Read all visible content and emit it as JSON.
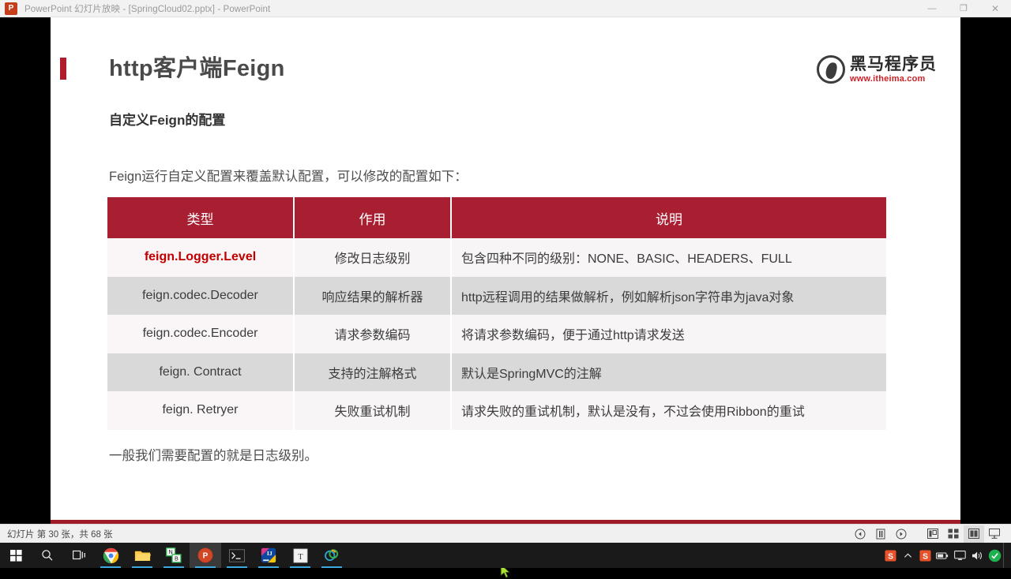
{
  "window": {
    "app_icon_label": "P",
    "title": "PowerPoint 幻灯片放映 - [SpringCloud02.pptx] - PowerPoint",
    "minimize_label": "—",
    "restore_label": "❐",
    "close_label": "✕"
  },
  "slide": {
    "title": "http客户端Feign",
    "subhead": "自定义Feign的配置",
    "intro": "Feign运行自定义配置来覆盖默认配置，可以修改的配置如下：",
    "closing": "一般我们需要配置的就是日志级别。",
    "accent_color": "#b01b2e",
    "header_color": "#a81f32",
    "footer_color": "#9e1b28",
    "highlight_color": "#c00000",
    "logo": {
      "brand_cn": "黑马程序员",
      "url": "www.itheima.com"
    },
    "table": {
      "headers": [
        "类型",
        "作用",
        "说明"
      ],
      "rows": [
        {
          "type": "feign.Logger.Level",
          "role": "修改日志级别",
          "desc": "包含四种不同的级别：NONE、BASIC、HEADERS、FULL",
          "highlight": true
        },
        {
          "type": "feign.codec.Decoder",
          "role": "响应结果的解析器",
          "desc": "http远程调用的结果做解析，例如解析json字符串为java对象",
          "highlight": false
        },
        {
          "type": "feign.codec.Encoder",
          "role": "请求参数编码",
          "desc": "将请求参数编码，便于通过http请求发送",
          "highlight": false
        },
        {
          "type": "feign. Contract",
          "role": "支持的注解格式",
          "desc": "默认是SpringMVC的注解",
          "highlight": false
        },
        {
          "type": "feign. Retryer",
          "role": "失败重试机制",
          "desc": "请求失败的重试机制，默认是没有，不过会使用Ribbon的重试",
          "highlight": false
        }
      ]
    }
  },
  "statusbar": {
    "slide_counter": "幻灯片 第 30 张，共 68 张",
    "controls": [
      {
        "name": "previous-slide-button"
      },
      {
        "name": "pause-slideshow-button"
      },
      {
        "name": "play-slideshow-button"
      },
      {
        "name": "normal-view-button"
      },
      {
        "name": "slide-sorter-view-button"
      },
      {
        "name": "reading-view-button"
      },
      {
        "name": "slideshow-view-button"
      }
    ]
  },
  "taskbar": {
    "items": [
      {
        "name": "start-button",
        "label": ""
      },
      {
        "name": "search-button",
        "label": ""
      },
      {
        "name": "task-view-button",
        "label": ""
      },
      {
        "name": "chrome-button",
        "label": ""
      },
      {
        "name": "file-explorer-button",
        "label": ""
      },
      {
        "name": "nginx-button",
        "label": "NB"
      },
      {
        "name": "powerpoint-button",
        "label": "P"
      },
      {
        "name": "terminal-button",
        "label": ""
      },
      {
        "name": "intellij-idea-button",
        "label": "IJ"
      },
      {
        "name": "typora-button",
        "label": "T"
      },
      {
        "name": "browser-button",
        "label": ""
      }
    ],
    "tray": [
      {
        "name": "sogou-input-icon",
        "label": "S"
      },
      {
        "name": "show-hidden-icons-chevron",
        "label": "⌃"
      },
      {
        "name": "sogou-pinyin-icon",
        "label": "S"
      },
      {
        "name": "battery-icon",
        "label": ""
      },
      {
        "name": "display-icon",
        "label": ""
      },
      {
        "name": "volume-icon",
        "label": ""
      },
      {
        "name": "security-icon",
        "label": ""
      }
    ]
  }
}
